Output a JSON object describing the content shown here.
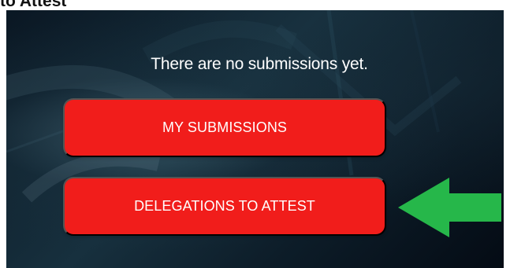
{
  "page": {
    "top_label": "to Attest"
  },
  "message": {
    "text": "There are no submissions yet."
  },
  "buttons": {
    "my_submissions": "MY SUBMISSIONS",
    "delegations_to_attest": "DELEGATIONS TO ATTEST"
  },
  "icons": {
    "arrow": "green-left-arrow-icon"
  },
  "colors": {
    "panel_background": "#0d1d29",
    "button_red": "#f11d1b",
    "button_text": "#ffffff",
    "message_text": "#ffffff",
    "arrow_green": "#26b74a"
  }
}
